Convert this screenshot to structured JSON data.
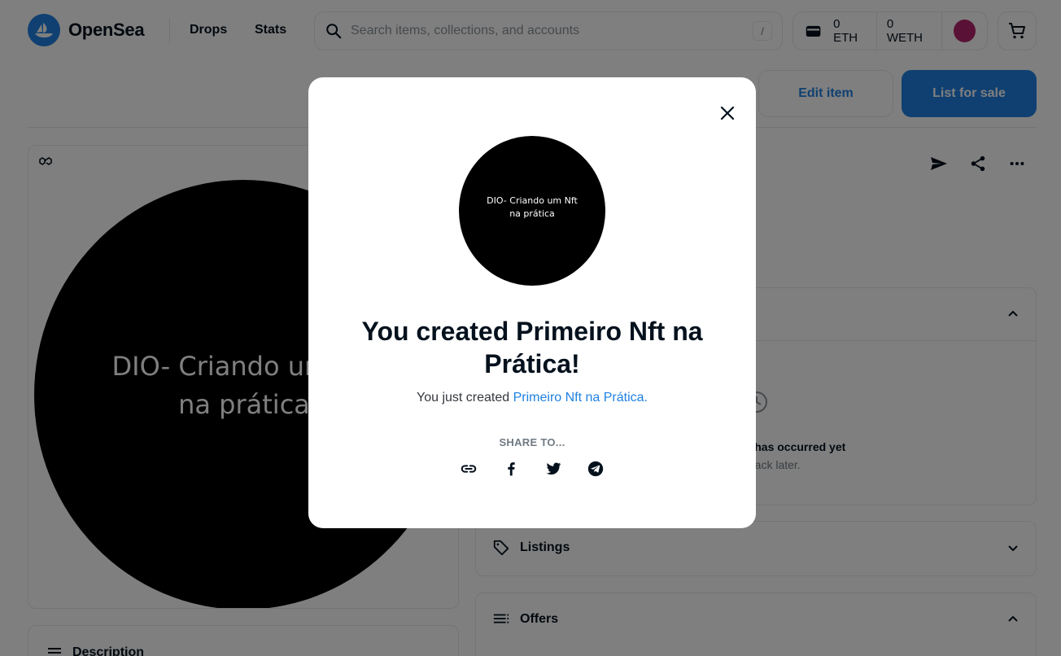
{
  "header": {
    "brand": "OpenSea",
    "nav": [
      "Drops",
      "Stats"
    ],
    "search_placeholder": "Search items, collections, and accounts",
    "search_shortcut": "/",
    "eth_balance": "0 ETH",
    "weth_balance": "0 WETH"
  },
  "actions": {
    "edit_label": "Edit item",
    "list_label": "List for sale"
  },
  "nft": {
    "image_text_line1": "DIO- Criando um Nft",
    "image_text_line2": "na prática"
  },
  "panels": {
    "activity_empty_title": "No trading data has occurred yet",
    "activity_empty_sub": "Check back later.",
    "listings_label": "Listings",
    "offers_label": "Offers",
    "description_label": "Description"
  },
  "modal": {
    "title": "You created Primeiro Nft na Prática!",
    "subtitle_prefix": "You just created ",
    "subtitle_link": "Primeiro Nft na Prática.",
    "share_label": "SHARE TO..."
  },
  "colors": {
    "accent": "#2081e2",
    "text": "#04111d",
    "muted": "#707a83",
    "border": "#e5e8eb"
  }
}
